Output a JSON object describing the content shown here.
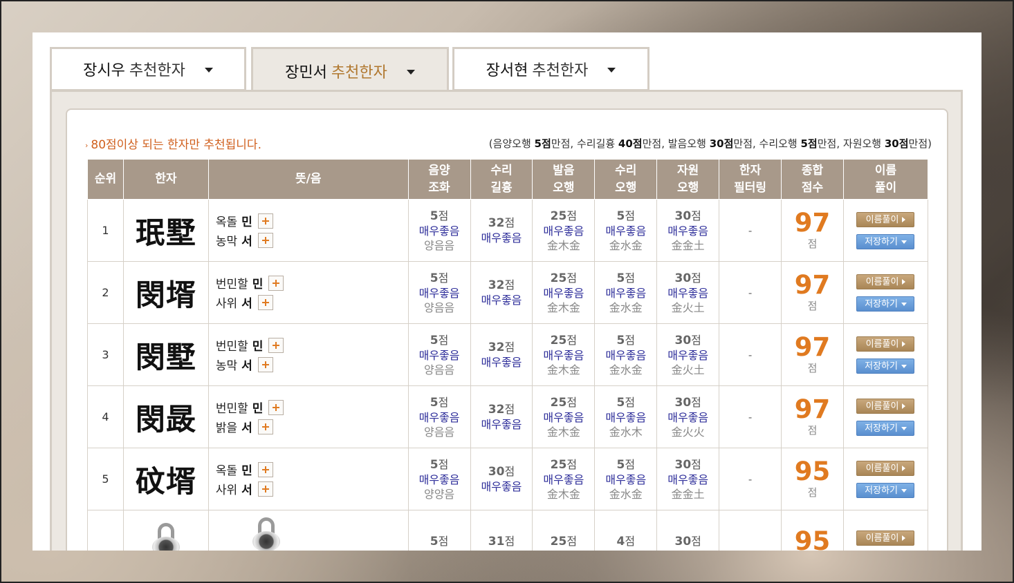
{
  "tabs": [
    {
      "name": "장시우",
      "suffix": "추천한자"
    },
    {
      "name": "장민서",
      "suffix": "추천한자"
    },
    {
      "name": "장서현",
      "suffix": "추천한자"
    }
  ],
  "notice": "80점이상 되는 한자만 추천됩니다.",
  "score_info": {
    "open": "(",
    "p1": "음양오행 ",
    "v1": "5점",
    "u1": "만점, ",
    "p2": "수리길흉 ",
    "v2": "40점",
    "u2": "만점, ",
    "p3": "발음오행 ",
    "v3": "30점",
    "u3": "만점, ",
    "p4": "수리오행 ",
    "v4": "5점",
    "u4": "만점, ",
    "p5": "자원오행 ",
    "v5": "30점",
    "u5": "만점)"
  },
  "headers": {
    "rank": "순위",
    "hanja": "한자",
    "meaning": "뜻/음",
    "eumyang1": "음양",
    "eumyang2": "조화",
    "suri1": "수리",
    "suri2": "길흉",
    "pronun1": "발음",
    "pronun2": "오행",
    "suriohang1": "수리",
    "suriohang2": "오행",
    "jawon1": "자원",
    "jawon2": "오행",
    "filter1": "한자",
    "filter2": "필터링",
    "total1": "종합",
    "total2": "점수",
    "explain1": "이름",
    "explain2": "풀이"
  },
  "rows": [
    {
      "rank": "1",
      "hanja": "珉墅",
      "m1": "옥돌",
      "r1": "민",
      "m2": "농막",
      "r2": "서",
      "s1": "5",
      "g1": "매우좋음",
      "x1": "양음음",
      "s2": "32",
      "g2": "매우좋음",
      "s3": "25",
      "g3": "매우좋음",
      "x3": "金木金",
      "s4": "5",
      "g4": "매우좋음",
      "x4": "金水金",
      "s5": "30",
      "g5": "매우좋음",
      "x5": "金金土",
      "filter": "-",
      "total": "97"
    },
    {
      "rank": "2",
      "hanja": "閔壻",
      "m1": "번민할",
      "r1": "민",
      "m2": "사위",
      "r2": "서",
      "s1": "5",
      "g1": "매우좋음",
      "x1": "양음음",
      "s2": "32",
      "g2": "매우좋음",
      "s3": "25",
      "g3": "매우좋음",
      "x3": "金木金",
      "s4": "5",
      "g4": "매우좋음",
      "x4": "金水金",
      "s5": "30",
      "g5": "매우좋음",
      "x5": "金火土",
      "filter": "-",
      "total": "97"
    },
    {
      "rank": "3",
      "hanja": "閔墅",
      "m1": "번민할",
      "r1": "민",
      "m2": "농막",
      "r2": "서",
      "s1": "5",
      "g1": "매우좋음",
      "x1": "양음음",
      "s2": "32",
      "g2": "매우좋음",
      "s3": "25",
      "g3": "매우좋음",
      "x3": "金木金",
      "s4": "5",
      "g4": "매우좋음",
      "x4": "金水金",
      "s5": "30",
      "g5": "매우좋음",
      "x5": "金火土",
      "filter": "-",
      "total": "97"
    },
    {
      "rank": "4",
      "hanja": "閔晸",
      "m1": "번민할",
      "r1": "민",
      "m2": "밝을",
      "r2": "서",
      "s1": "5",
      "g1": "매우좋음",
      "x1": "양음음",
      "s2": "32",
      "g2": "매우좋음",
      "s3": "25",
      "g3": "매우좋음",
      "x3": "金木金",
      "s4": "5",
      "g4": "매우좋음",
      "x4": "金水木",
      "s5": "30",
      "g5": "매우좋음",
      "x5": "金火火",
      "filter": "-",
      "total": "97"
    },
    {
      "rank": "5",
      "hanja": "砇壻",
      "m1": "옥돌",
      "r1": "민",
      "m2": "사위",
      "r2": "서",
      "s1": "5",
      "g1": "매우좋음",
      "x1": "양양음",
      "s2": "30",
      "g2": "매우좋음",
      "s3": "25",
      "g3": "매우좋음",
      "x3": "金木金",
      "s4": "5",
      "g4": "매우좋음",
      "x4": "金水金",
      "s5": "30",
      "g5": "매우좋음",
      "x5": "金金土",
      "filter": "-",
      "total": "95"
    },
    {
      "s1": "5",
      "s2": "31",
      "s3": "25",
      "s4": "4",
      "s5": "30",
      "total": "95"
    }
  ],
  "unit_point": "점",
  "btn_explain": "이름풀이",
  "btn_save": "저장하기"
}
